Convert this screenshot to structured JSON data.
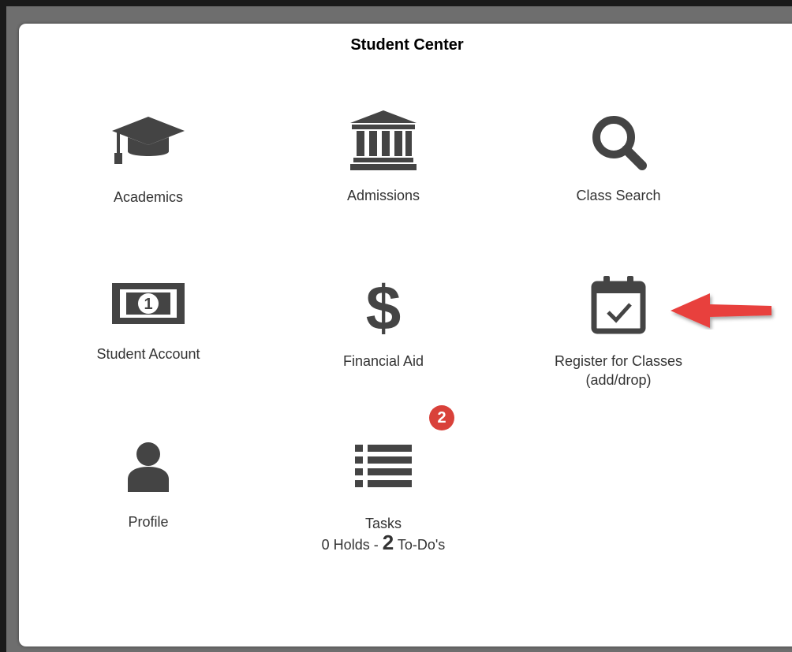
{
  "header": {
    "title": "Student Center"
  },
  "tiles": [
    {
      "label": "Academics",
      "icon": "graduation-cap-icon"
    },
    {
      "label": "Admissions",
      "icon": "institution-icon"
    },
    {
      "label": "Class Search",
      "icon": "search-icon"
    },
    {
      "label": "Student Account",
      "icon": "money-bill-icon"
    },
    {
      "label": "Financial Aid",
      "icon": "dollar-sign-icon"
    },
    {
      "label": "Register for Classes",
      "sublabel": "(add/drop)",
      "icon": "calendar-check-icon"
    },
    {
      "label": "Profile",
      "icon": "user-icon"
    },
    {
      "label": "Tasks",
      "icon": "list-icon",
      "badge": "2",
      "holds_text": "0 Holds - ",
      "todo_count": "2",
      "todo_text": " To-Do's"
    }
  ],
  "colors": {
    "icon": "#444444",
    "badge": "#d9413a",
    "arrow": "#e8413e"
  }
}
